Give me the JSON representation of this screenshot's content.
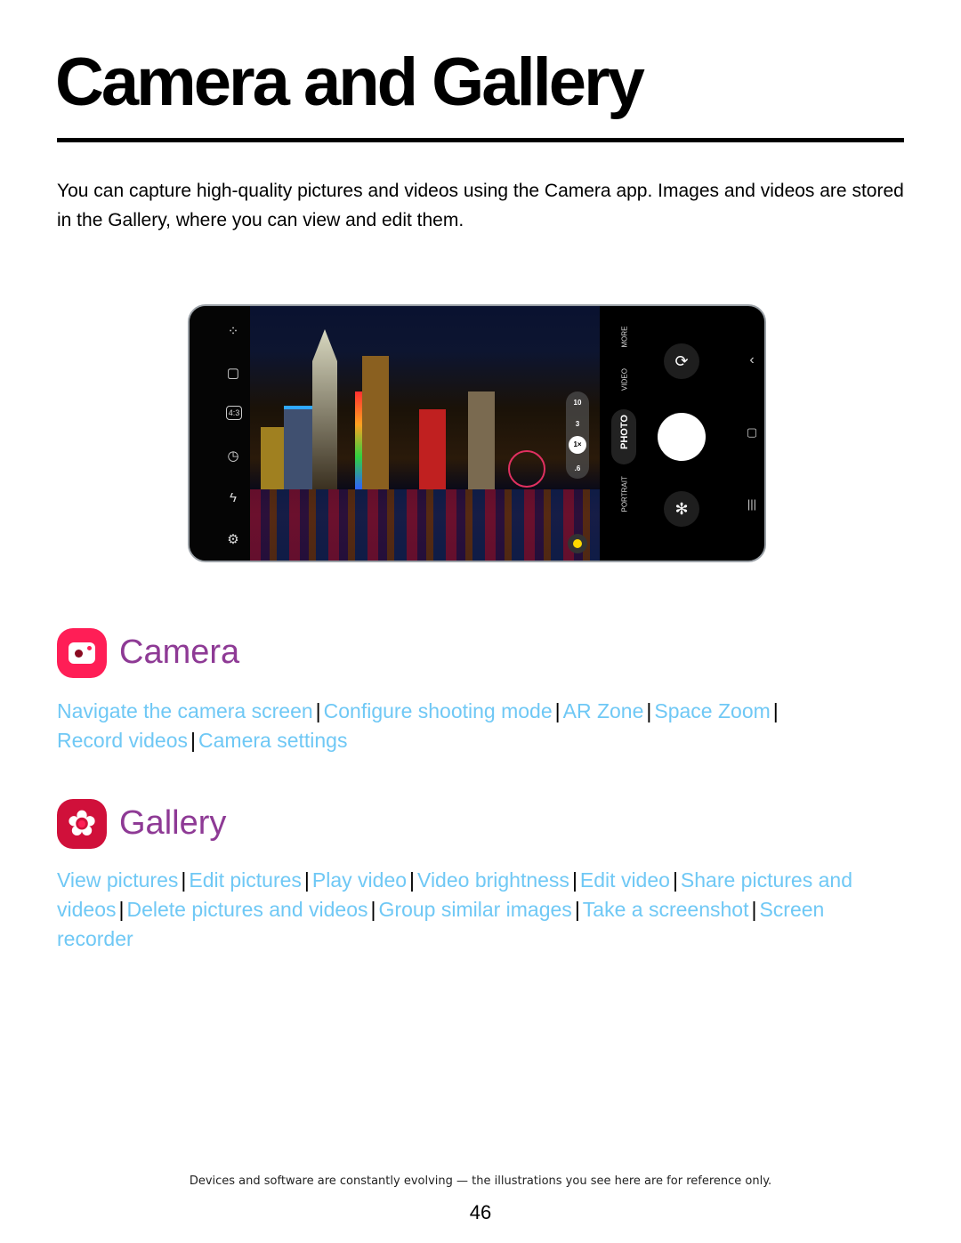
{
  "page": {
    "title": "Camera and Gallery",
    "intro": "You can capture high-quality pictures and videos using the Camera app. Images and videos are stored in the Gallery, where you can view and edit them.",
    "footer_note": "Devices and software are constantly evolving — the illustrations you see here are for reference only.",
    "page_number": "46"
  },
  "illustration": {
    "left_icons": [
      "effects-icon",
      "motion-photo-icon",
      "aspect-ratio-icon",
      "timer-icon",
      "flash-off-icon",
      "settings-icon"
    ],
    "aspect_ratio_label": "4:3",
    "zoom_levels": [
      "10",
      "3",
      "1×",
      ".6"
    ],
    "selected_zoom": "1×",
    "modes": [
      "MORE",
      "VIDEO",
      "PHOTO",
      "PORTRAIT"
    ],
    "selected_mode": "PHOTO"
  },
  "sections": [
    {
      "title": "Camera",
      "icon": "camera-app-icon",
      "icon_color": "#ff1e56",
      "links": [
        "Navigate the camera screen",
        "Configure shooting mode",
        "AR Zone",
        "Space Zoom",
        "Record videos",
        "Camera settings"
      ]
    },
    {
      "title": "Gallery",
      "icon": "gallery-app-icon",
      "icon_color": "#d0103a",
      "links": [
        "View pictures",
        "Edit pictures",
        "Play video",
        "Video brightness",
        "Edit video",
        "Share pictures and videos",
        "Delete pictures and videos",
        "Group similar images",
        "Take a screenshot",
        "Screen recorder"
      ]
    }
  ],
  "colors": {
    "link": "#6fc8f5",
    "section_title": "#8e3a95"
  }
}
